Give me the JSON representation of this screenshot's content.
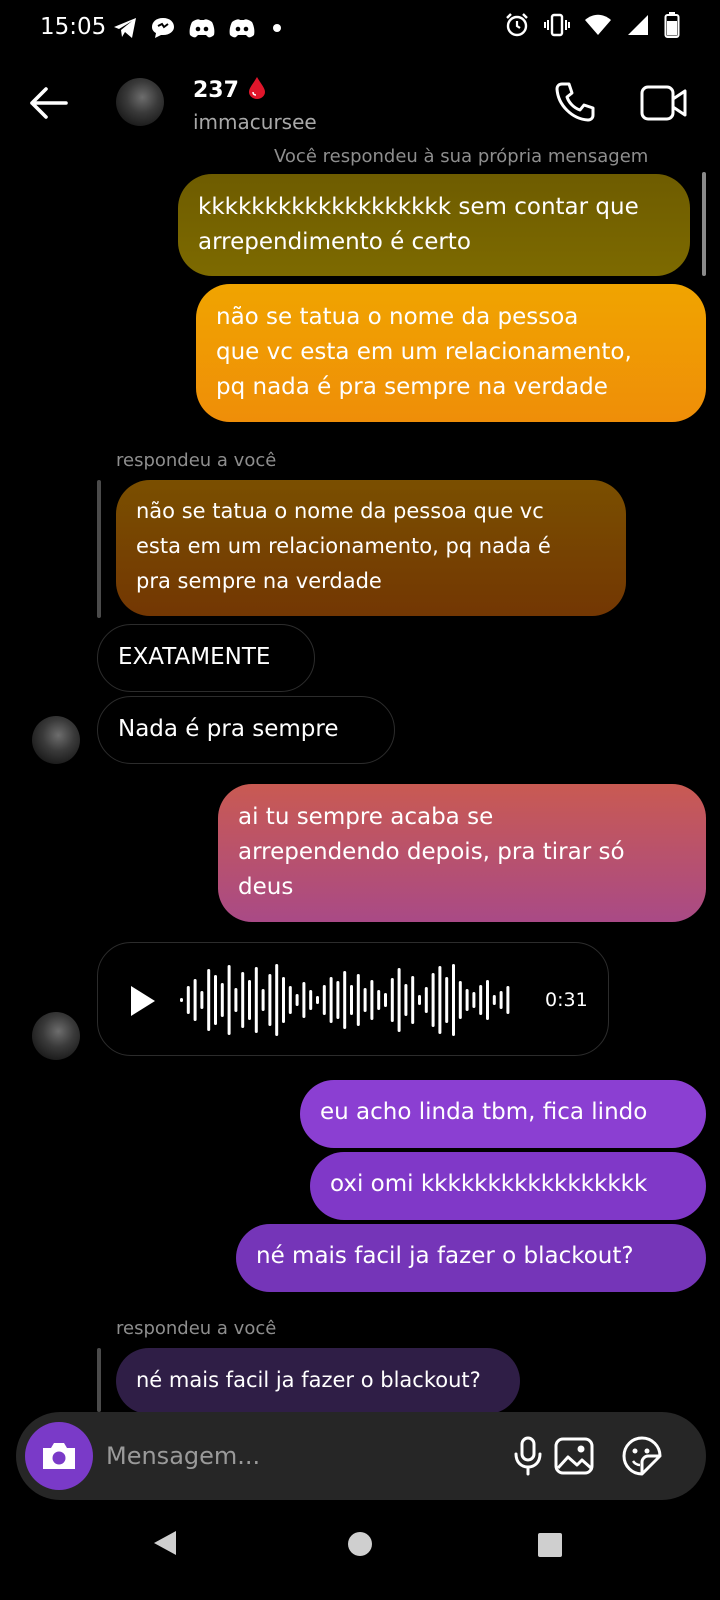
{
  "status_bar": {
    "time": "15:05",
    "notification_icons": [
      "telegram-icon",
      "chat-bubble-icon",
      "discord-icon",
      "discord-icon",
      "dot-icon"
    ],
    "system_icons": [
      "alarm-icon",
      "vibrate-icon",
      "wifi-icon",
      "signal-icon",
      "battery-icon"
    ]
  },
  "header": {
    "name": "237",
    "name_icon": "blood-drop-icon",
    "handle": "immacursee",
    "colors": {
      "drop": "#e0162b"
    }
  },
  "messages": {
    "top_meta": "Você respondeu à sua própria mensagem",
    "m1": {
      "line1": "kkkkkkkkkkkkkkkkkkk sem contar que",
      "line2": "arrependimento é certo"
    },
    "m2": {
      "line1": "não se tatua o nome da pessoa",
      "line2": "que vc esta em um relacionamento,",
      "line3": "pq nada é pra sempre na verdade"
    },
    "reply_meta_1": "respondeu a você",
    "m3": {
      "line1": "não se tatua o nome da pessoa que vc",
      "line2": "esta em um relacionamento, pq nada é",
      "line3": "pra sempre na verdade"
    },
    "m4": "EXATAMENTE",
    "m5": "Nada é pra sempre",
    "m6": {
      "line1": "ai tu sempre acaba se",
      "line2": "arrependendo depois, pra tirar só",
      "line3": "deus"
    },
    "voice_duration": "0:31",
    "m7": "eu acho linda tbm, fica lindo",
    "m8": "oxi omi kkkkkkkkkkkkkkkkk",
    "m9": "né mais facil ja fazer o blackout?",
    "reply_meta_2": "respondeu a você",
    "m10": "né mais facil ja fazer o blackout?"
  },
  "composer": {
    "placeholder": "Mensagem...",
    "icons": [
      "camera-icon",
      "microphone-icon",
      "gallery-icon",
      "sticker-icon"
    ]
  },
  "nav": {
    "icons": [
      "back-triangle-icon",
      "home-circle-icon",
      "recents-square-icon"
    ]
  },
  "colors": {
    "m1_bg": [
      "#6e5c00",
      "#7d6a00"
    ],
    "m2_bg": [
      "#f0a400",
      "#ef8e08"
    ],
    "m3_bg": [
      "#7a4f00",
      "#733703"
    ],
    "m6_bg": [
      "#c95a52",
      "#a94a86"
    ],
    "m7_bg": "#8b3fd2",
    "m8_bg": "#8038c8",
    "m9_bg": "#7535b8",
    "m10_bg": "#2f1e46",
    "camera_btn": "#7a3ac8"
  }
}
